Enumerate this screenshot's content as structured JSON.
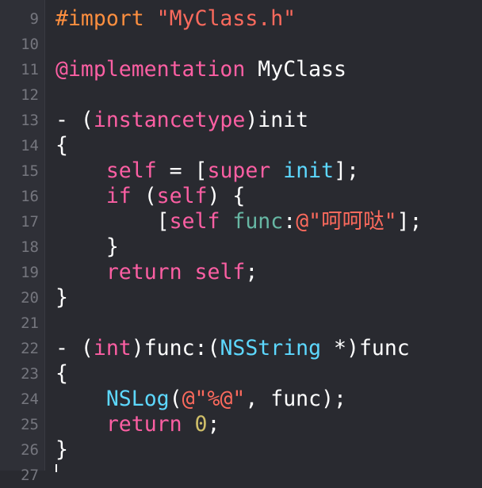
{
  "editor": {
    "language": "objective-c",
    "lines": [
      {
        "n": "9",
        "tokens": [
          {
            "t": "#import ",
            "c": "#fd8f3f"
          },
          {
            "t": "\"MyClass.h\"",
            "c": "#fc6a5d"
          }
        ]
      },
      {
        "n": "10",
        "tokens": []
      },
      {
        "n": "11",
        "tokens": [
          {
            "t": "@implementation",
            "c": "#fc5fa3"
          },
          {
            "t": " MyClass",
            "c": "#ffffff"
          }
        ]
      },
      {
        "n": "12",
        "tokens": []
      },
      {
        "n": "13",
        "tokens": [
          {
            "t": "- (",
            "c": "#ffffff"
          },
          {
            "t": "instancetype",
            "c": "#fc5fa3"
          },
          {
            "t": ")init",
            "c": "#ffffff"
          }
        ]
      },
      {
        "n": "14",
        "tokens": [
          {
            "t": "{",
            "c": "#ffffff"
          }
        ]
      },
      {
        "n": "15",
        "tokens": [
          {
            "t": "    ",
            "c": "#ffffff"
          },
          {
            "t": "self",
            "c": "#fc5fa3"
          },
          {
            "t": " = [",
            "c": "#ffffff"
          },
          {
            "t": "super",
            "c": "#fc5fa3"
          },
          {
            "t": " ",
            "c": "#ffffff"
          },
          {
            "t": "init",
            "c": "#5dd8ff"
          },
          {
            "t": "];",
            "c": "#ffffff"
          }
        ]
      },
      {
        "n": "16",
        "tokens": [
          {
            "t": "    ",
            "c": "#ffffff"
          },
          {
            "t": "if",
            "c": "#fc5fa3"
          },
          {
            "t": " (",
            "c": "#ffffff"
          },
          {
            "t": "self",
            "c": "#fc5fa3"
          },
          {
            "t": ") {",
            "c": "#ffffff"
          }
        ]
      },
      {
        "n": "17",
        "tokens": [
          {
            "t": "        [",
            "c": "#ffffff"
          },
          {
            "t": "self",
            "c": "#fc5fa3"
          },
          {
            "t": " ",
            "c": "#ffffff"
          },
          {
            "t": "func",
            "c": "#67b7a4"
          },
          {
            "t": ":",
            "c": "#ffffff"
          },
          {
            "t": "@\"呵呵哒\"",
            "c": "#fc6a5d"
          },
          {
            "t": "];",
            "c": "#ffffff"
          }
        ]
      },
      {
        "n": "18",
        "tokens": [
          {
            "t": "    }",
            "c": "#ffffff"
          }
        ]
      },
      {
        "n": "19",
        "tokens": [
          {
            "t": "    ",
            "c": "#ffffff"
          },
          {
            "t": "return",
            "c": "#fc5fa3"
          },
          {
            "t": " ",
            "c": "#ffffff"
          },
          {
            "t": "self",
            "c": "#fc5fa3"
          },
          {
            "t": ";",
            "c": "#ffffff"
          }
        ]
      },
      {
        "n": "20",
        "tokens": [
          {
            "t": "}",
            "c": "#ffffff"
          }
        ]
      },
      {
        "n": "21",
        "tokens": []
      },
      {
        "n": "22",
        "tokens": [
          {
            "t": "- (",
            "c": "#ffffff"
          },
          {
            "t": "int",
            "c": "#fc5fa3"
          },
          {
            "t": ")func:(",
            "c": "#ffffff"
          },
          {
            "t": "NSString",
            "c": "#5dd8ff"
          },
          {
            "t": " *)func",
            "c": "#ffffff"
          }
        ]
      },
      {
        "n": "23",
        "tokens": [
          {
            "t": "{",
            "c": "#ffffff"
          }
        ]
      },
      {
        "n": "24",
        "tokens": [
          {
            "t": "    ",
            "c": "#ffffff"
          },
          {
            "t": "NSLog",
            "c": "#5dd8ff"
          },
          {
            "t": "(",
            "c": "#ffffff"
          },
          {
            "t": "@\"%@\"",
            "c": "#fc6a5d"
          },
          {
            "t": ", func);",
            "c": "#ffffff"
          }
        ]
      },
      {
        "n": "25",
        "tokens": [
          {
            "t": "    ",
            "c": "#ffffff"
          },
          {
            "t": "return",
            "c": "#fc5fa3"
          },
          {
            "t": " ",
            "c": "#ffffff"
          },
          {
            "t": "0",
            "c": "#d0bf69"
          },
          {
            "t": ";",
            "c": "#ffffff"
          }
        ]
      },
      {
        "n": "26",
        "tokens": [
          {
            "t": "}",
            "c": "#ffffff"
          }
        ]
      },
      {
        "n": "27",
        "tokens": []
      }
    ]
  }
}
